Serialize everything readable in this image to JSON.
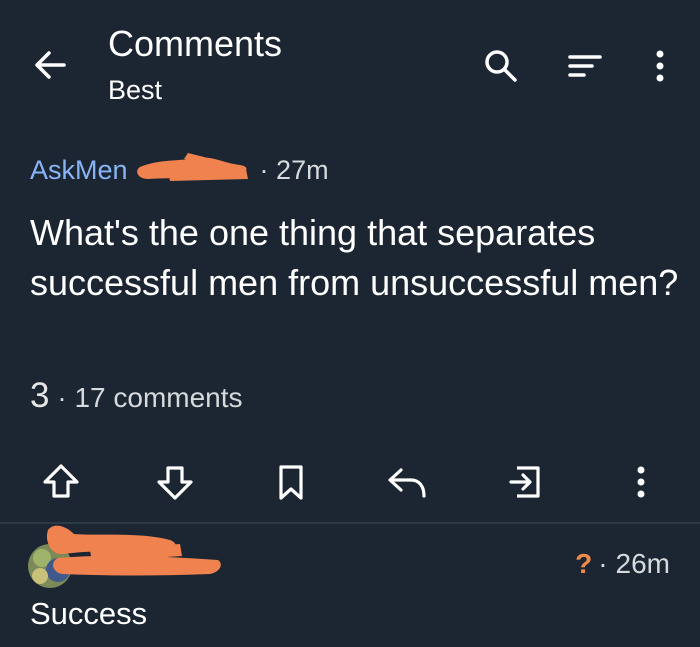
{
  "header": {
    "title": "Comments",
    "subtitle": "Best",
    "icons": [
      "arrow-left-icon",
      "search-icon",
      "sort-icon",
      "more-vertical-icon"
    ]
  },
  "post": {
    "subreddit": "AskMen",
    "time": "27m",
    "title": "What's the one thing that separates successful men from unsuccessful men?",
    "score": "3",
    "separator": "·",
    "comments": "17 comments",
    "actions": [
      "upvote-icon",
      "downvote-icon",
      "bookmark-icon",
      "reply-icon",
      "share-icon",
      "more-vertical-icon"
    ]
  },
  "comment": {
    "flair": "?",
    "separator": "·",
    "time": "26m",
    "body": "Success"
  },
  "colors": {
    "background": "#1c2632",
    "subreddit_link": "#8ab4f8",
    "redaction": "#f0824f",
    "flair": "#f08a4b"
  }
}
